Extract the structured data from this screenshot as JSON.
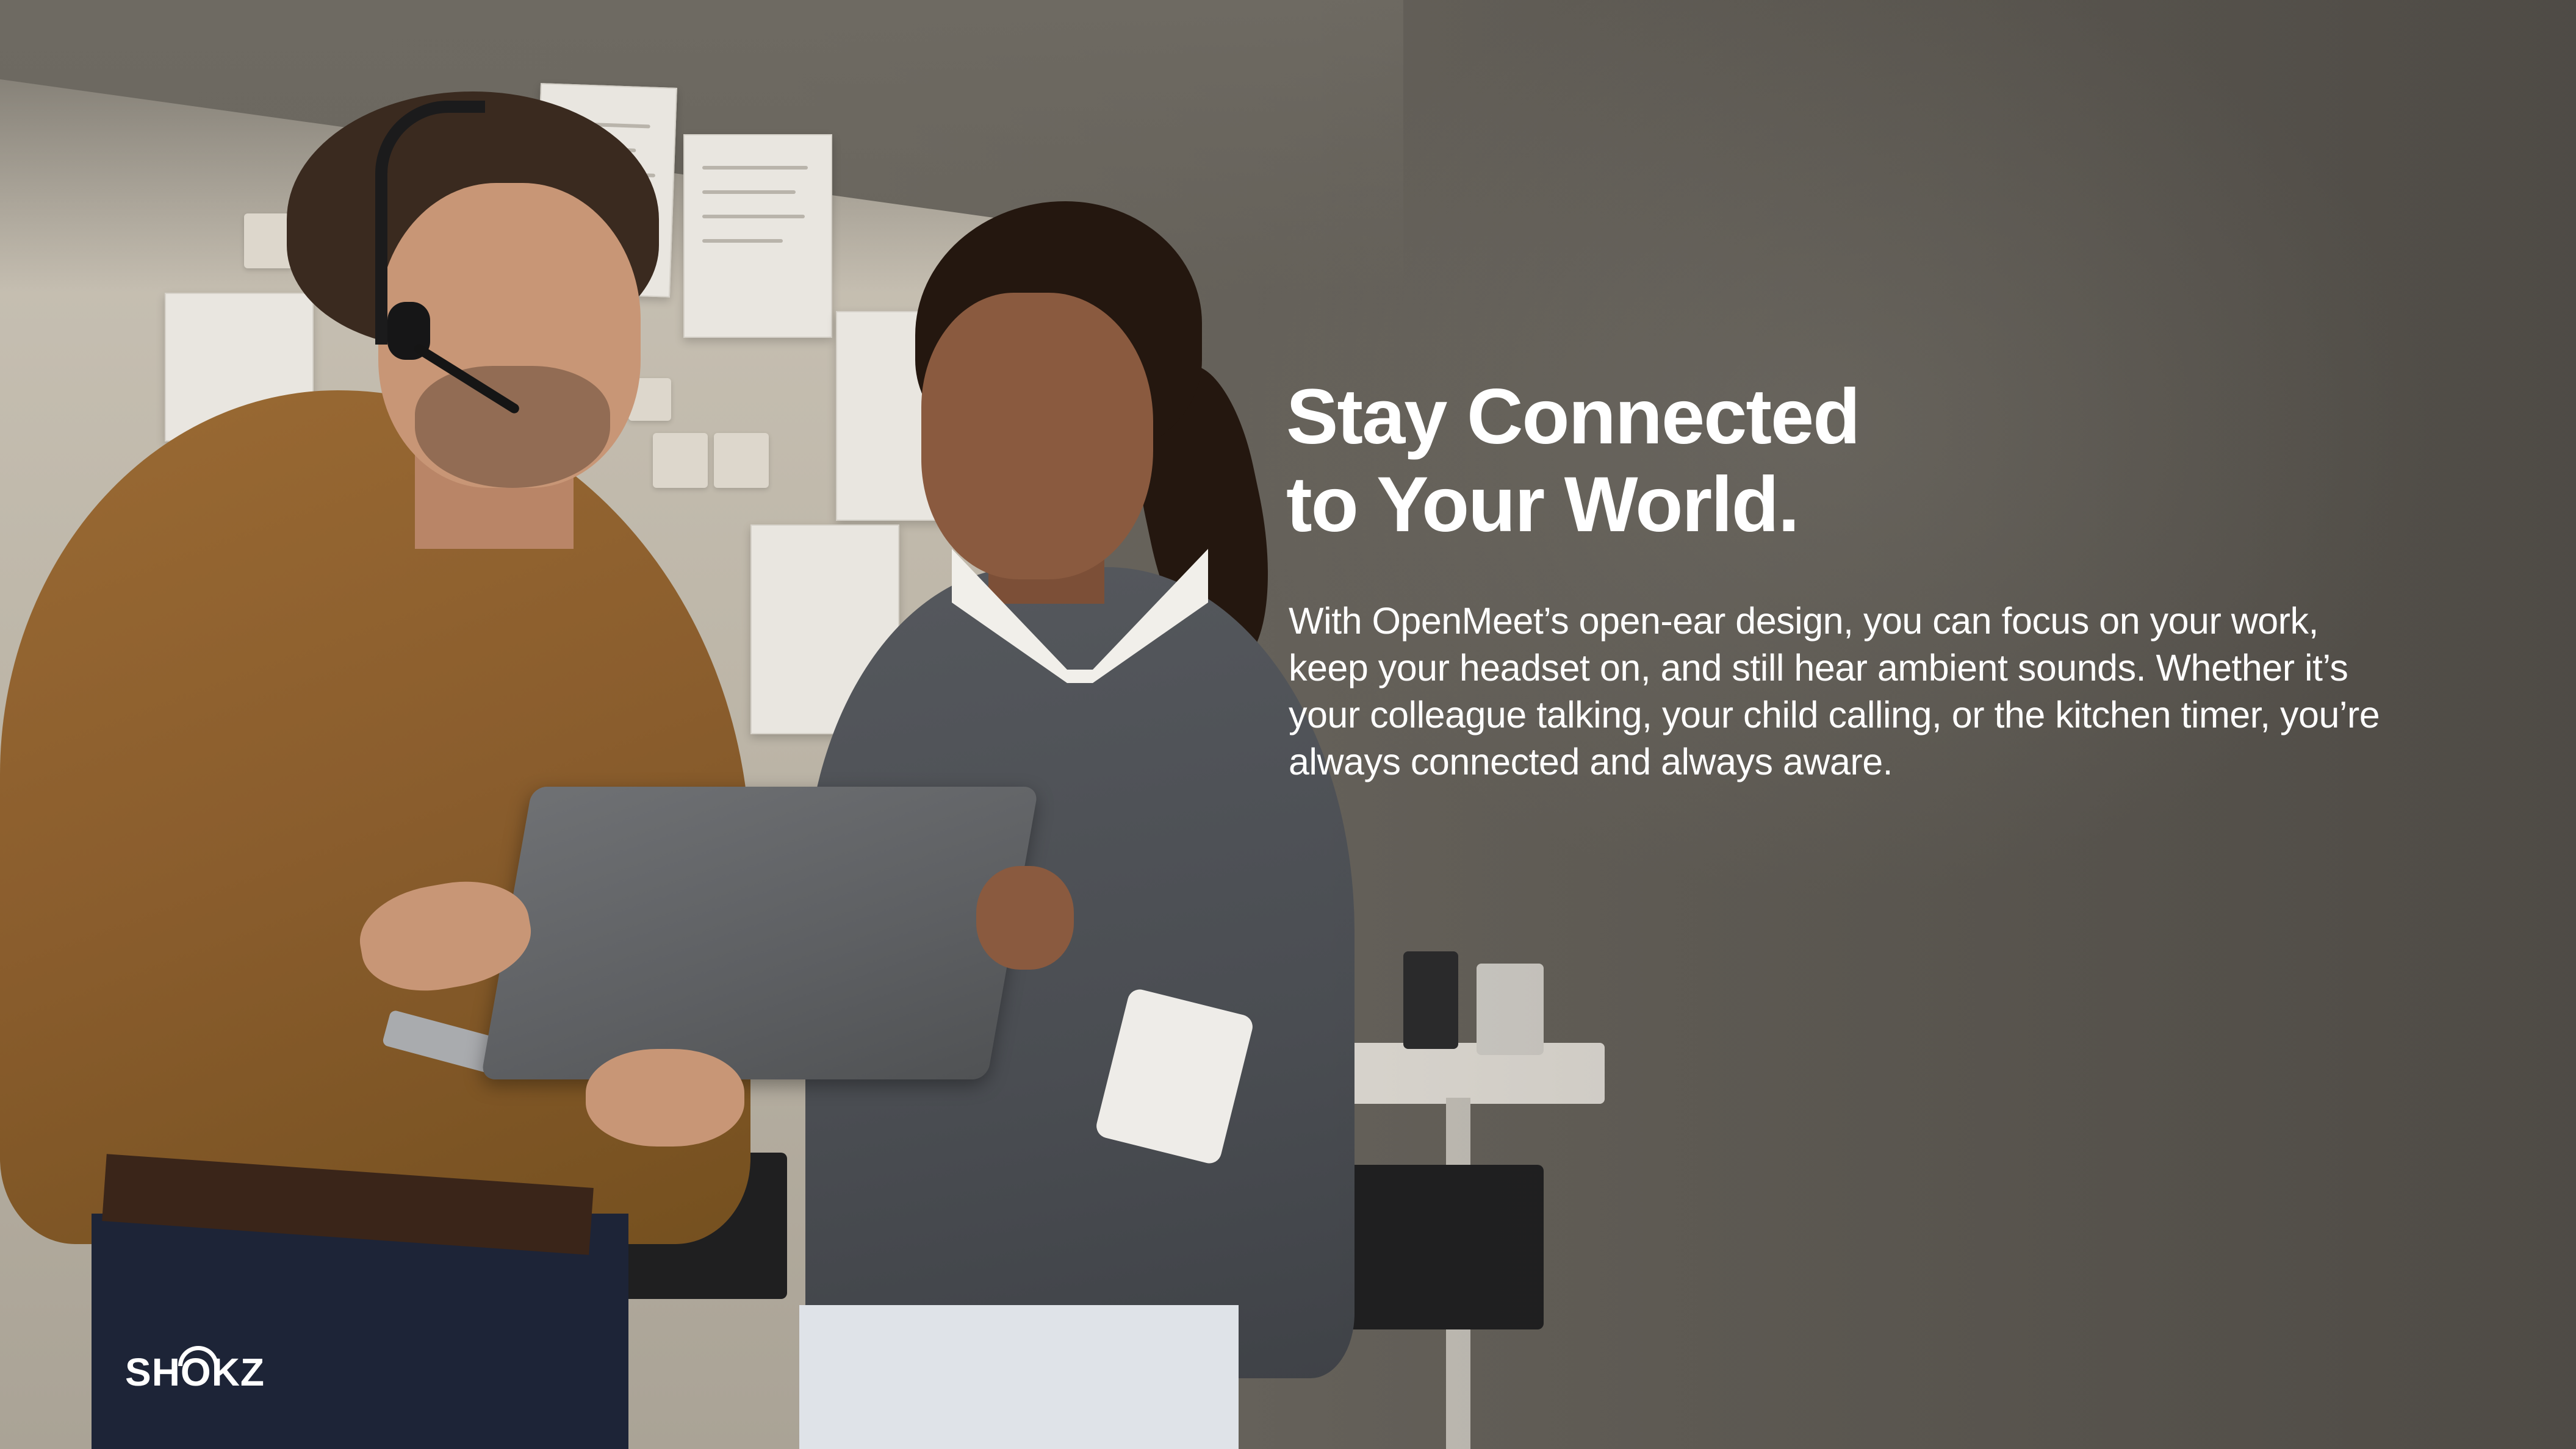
{
  "headline": {
    "line1": "Stay Connected",
    "line2": "to Your World."
  },
  "body_text": "With OpenMeet’s open-ear design, you can focus on your work, keep your headset on, and still hear ambient sounds. Whether it’s your colleague talking, your child calling, or the kitchen timer, you’re always connected and always aware.",
  "brand": {
    "logo_text": "SHOKZ",
    "logo_color": "#ffffff"
  },
  "colors": {
    "background": "#5c5852",
    "text": "#ffffff"
  }
}
